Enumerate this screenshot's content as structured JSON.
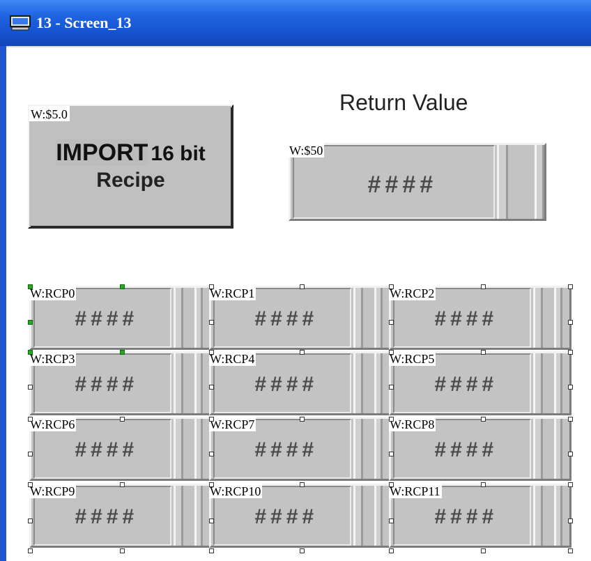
{
  "window": {
    "title": "13 - Screen_13",
    "icon": "monitor-icon"
  },
  "import_button": {
    "tag": "W:$5.0",
    "line1_a": "IMPORT",
    "line1_b": "16 bit",
    "line2": "Recipe"
  },
  "return": {
    "label": "Return Value",
    "tag": "W:$50",
    "value": "####"
  },
  "recipes": [
    {
      "tag": "W:RCP0",
      "value": "####"
    },
    {
      "tag": "W:RCP1",
      "value": "####"
    },
    {
      "tag": "W:RCP2",
      "value": "####"
    },
    {
      "tag": "W:RCP3",
      "value": "####"
    },
    {
      "tag": "W:RCP4",
      "value": "####"
    },
    {
      "tag": "W:RCP5",
      "value": "####"
    },
    {
      "tag": "W:RCP6",
      "value": "####"
    },
    {
      "tag": "W:RCP7",
      "value": "####"
    },
    {
      "tag": "W:RCP8",
      "value": "####"
    },
    {
      "tag": "W:RCP9",
      "value": "####"
    },
    {
      "tag": "W:RCP10",
      "value": "####"
    },
    {
      "tag": "W:RCP11",
      "value": "####"
    }
  ],
  "colors": {
    "titlebar": "#1f63e0",
    "field_bg": "#c3c3c3",
    "selection_handle": "#22aa22"
  }
}
